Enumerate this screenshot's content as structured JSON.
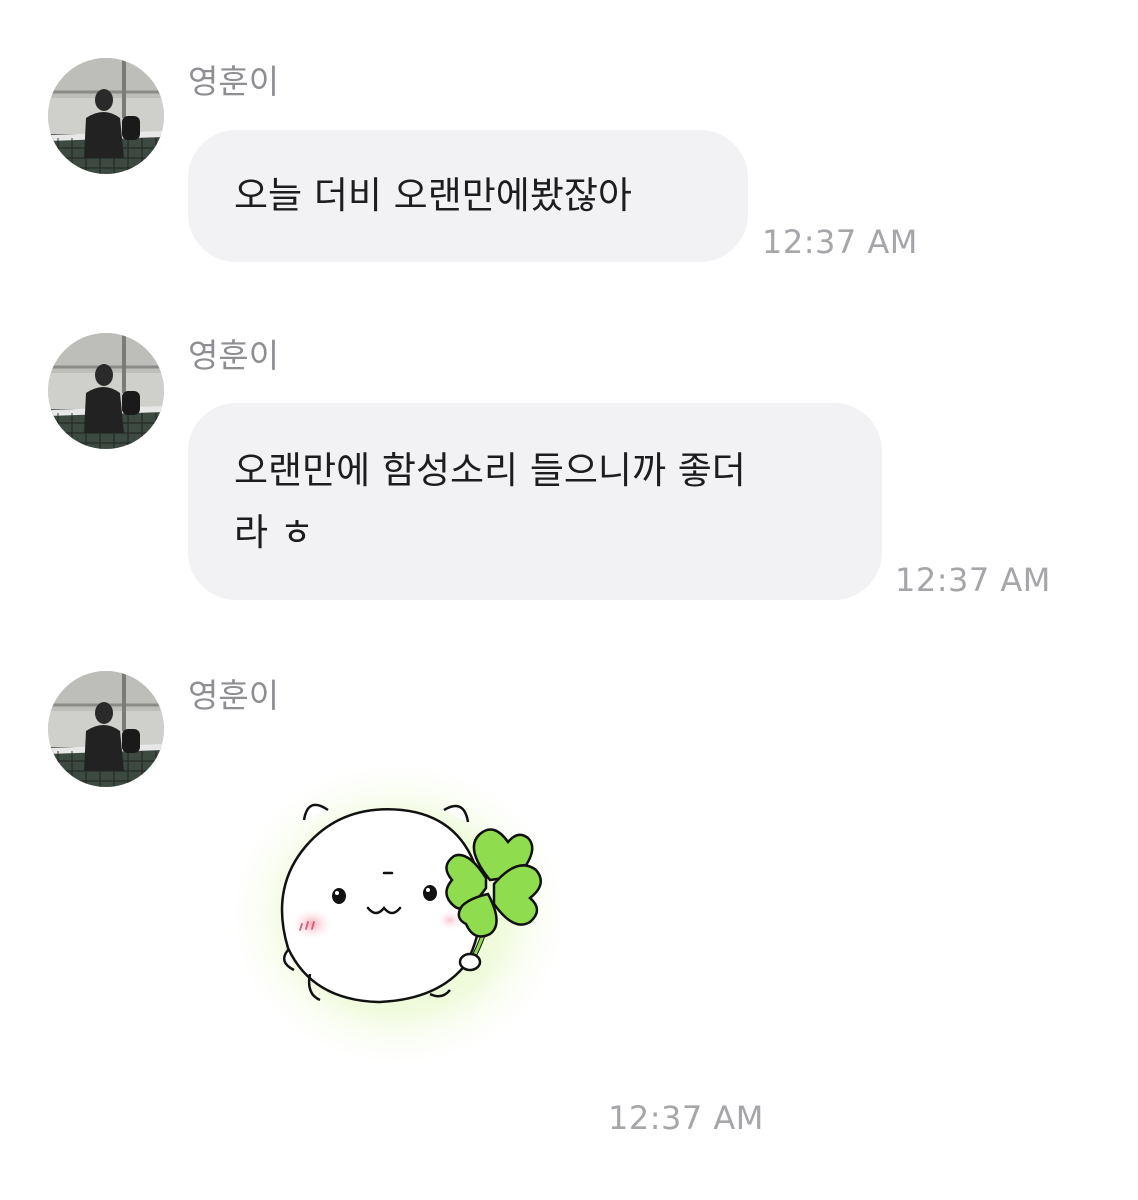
{
  "chat": {
    "messages": [
      {
        "sender": "영훈이",
        "type": "text",
        "text": "오늘 더비 오랜만에봤잖아",
        "time": "12:37 AM",
        "avatar_icon": "profile-photo"
      },
      {
        "sender": "영훈이",
        "type": "text",
        "text_line1": "오랜만에 함성소리 들으니까 좋더",
        "text_line2": "라 ㅎ",
        "time": "12:37 AM",
        "avatar_icon": "profile-photo"
      },
      {
        "sender": "영훈이",
        "type": "sticker",
        "sticker_icon": "hamster-holding-clover-sticker",
        "time": "12:37 AM",
        "avatar_icon": "profile-photo"
      }
    ]
  },
  "colors": {
    "bubble_background": "#f2f2f5",
    "sender_text": "#8e8e93",
    "timestamp_text": "#a6a6aa",
    "message_text": "#1d1d1f",
    "clover_green": "#8fdc4f",
    "sticker_glow": "#e9f8c8"
  }
}
